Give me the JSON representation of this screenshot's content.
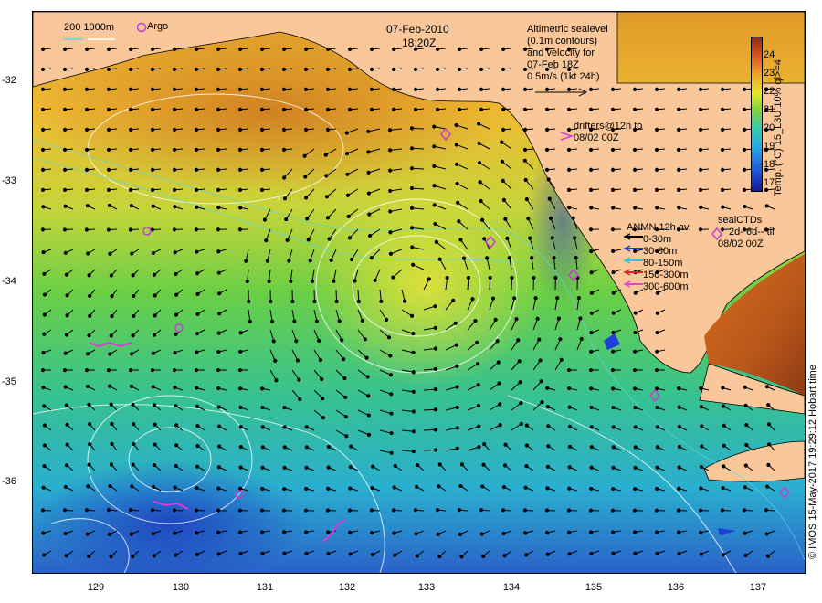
{
  "map": {
    "date": "07-Feb-2010",
    "time": "18:20Z",
    "scale_bar": "200  1000m",
    "argo_label": "Argo",
    "altimetry_lines": [
      "Altimetric sealevel",
      "(0.1m contours)",
      "and velocity for",
      "07-Feb 18Z",
      "0.5m/s (1kt 24h)"
    ],
    "drifters_lines": [
      "drifters@12h to",
      "08/02 00Z"
    ],
    "anmn_title": "ANMN 12h av.",
    "anmn_legend": [
      {
        "label": "0-30m",
        "color": "#000000"
      },
      {
        "label": "30-80m",
        "color": "#1f3fd8"
      },
      {
        "label": "80-150m",
        "color": "#29c7d8"
      },
      {
        "label": "150-300m",
        "color": "#d8261f"
      },
      {
        "label": "300-600m",
        "color": "#e83fd8"
      }
    ],
    "sealctd_lines": [
      "sealCTDs",
      "2d- 6d-- til",
      "08/02 00Z"
    ],
    "colorbar_title": "Temp. (°C) 15_L3U 10% ql>=4",
    "colorbar_ticks": [
      "24",
      "23",
      "22",
      "21",
      "20",
      "19",
      "18",
      "17"
    ],
    "colorbar_range": [
      16.5,
      25
    ],
    "credit": "© IMOS 15-May-2017 19:29:12 Hobart time",
    "lat_ticks": [
      "-32",
      "-33",
      "-34",
      "-35",
      "-36"
    ],
    "lon_ticks": [
      "129",
      "130",
      "131",
      "132",
      "133",
      "134",
      "135",
      "136",
      "137"
    ],
    "colors": {
      "land": "#f9c79a",
      "accent": "#c83cd0"
    }
  }
}
